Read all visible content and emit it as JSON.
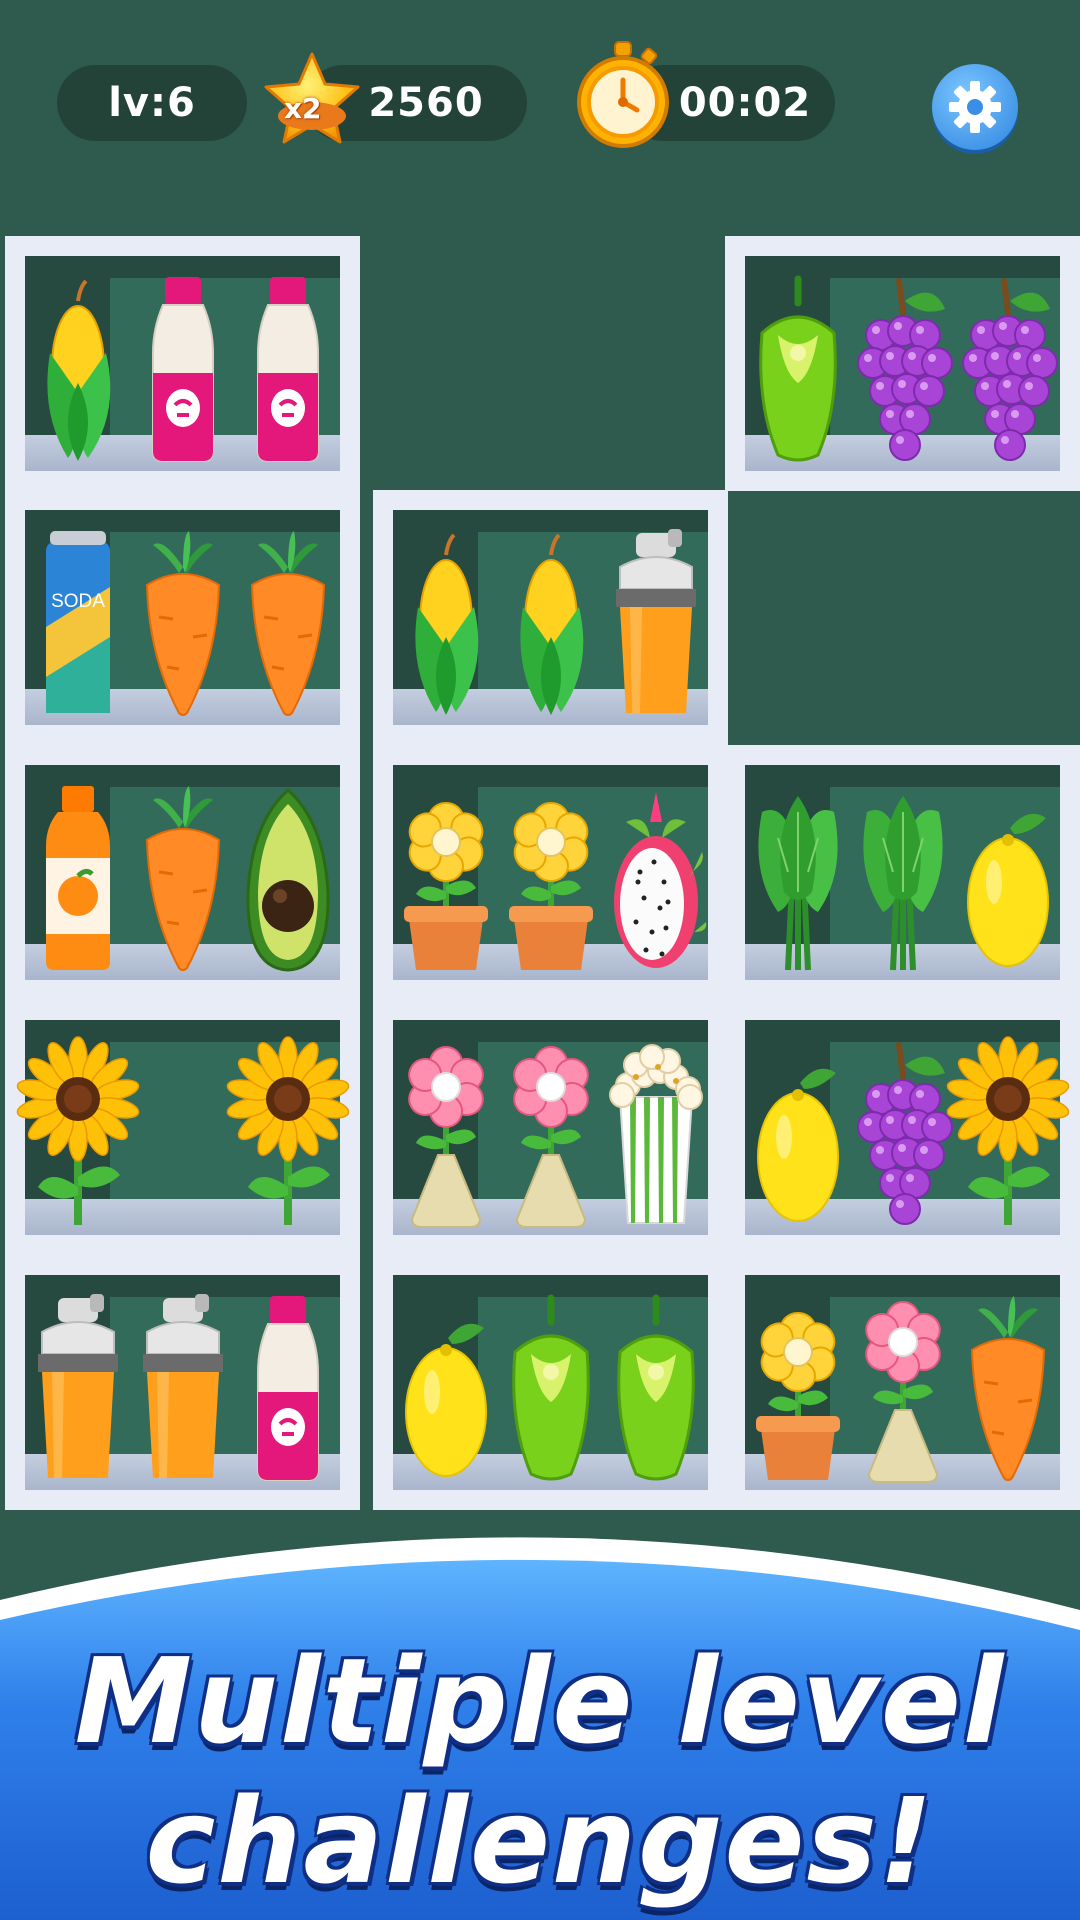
{
  "hud": {
    "level_label": "lv:6",
    "multiplier": "x2",
    "score": "2560",
    "timer": "00:02"
  },
  "banner": {
    "line1": "Multiple level",
    "line2": "challenges!"
  },
  "colors": {
    "background": "#2f5a4e",
    "pill": "#234339",
    "shelf_frame": "#e7ecf6",
    "banner_blue": "#2f7fe6",
    "settings_blue": "#3a8ee6"
  },
  "shelves": [
    {
      "row": 0,
      "col": 0,
      "items": [
        "corn",
        "milk-bottle",
        "milk-bottle"
      ]
    },
    {
      "row": 0,
      "col": 2,
      "items": [
        "green-pepper",
        "grapes",
        "grapes"
      ]
    },
    {
      "row": 1,
      "col": 0,
      "items": [
        "soda-can",
        "carrot",
        "carrot"
      ]
    },
    {
      "row": 1,
      "col": 1,
      "items": [
        "corn",
        "corn",
        "shaker-cup"
      ]
    },
    {
      "row": 2,
      "col": 0,
      "items": [
        "orange-juice",
        "carrot",
        "avocado"
      ]
    },
    {
      "row": 2,
      "col": 1,
      "items": [
        "yellow-flower-pot",
        "yellow-flower-pot",
        "dragon-fruit"
      ]
    },
    {
      "row": 2,
      "col": 2,
      "items": [
        "spinach",
        "spinach",
        "lemon"
      ]
    },
    {
      "row": 3,
      "col": 0,
      "items": [
        "sunflower",
        "",
        "sunflower"
      ]
    },
    {
      "row": 3,
      "col": 1,
      "items": [
        "pink-flower-vase",
        "pink-flower-vase",
        "popcorn"
      ]
    },
    {
      "row": 3,
      "col": 2,
      "items": [
        "lemon",
        "grapes",
        "sunflower"
      ]
    },
    {
      "row": 4,
      "col": 0,
      "items": [
        "shaker-cup",
        "shaker-cup",
        "milk-bottle"
      ]
    },
    {
      "row": 4,
      "col": 1,
      "items": [
        "lemon",
        "green-pepper",
        "green-pepper"
      ]
    },
    {
      "row": 4,
      "col": 2,
      "items": [
        "yellow-flower-pot",
        "pink-flower-vase",
        "carrot"
      ]
    }
  ],
  "labels": {
    "soda": "SODA"
  }
}
